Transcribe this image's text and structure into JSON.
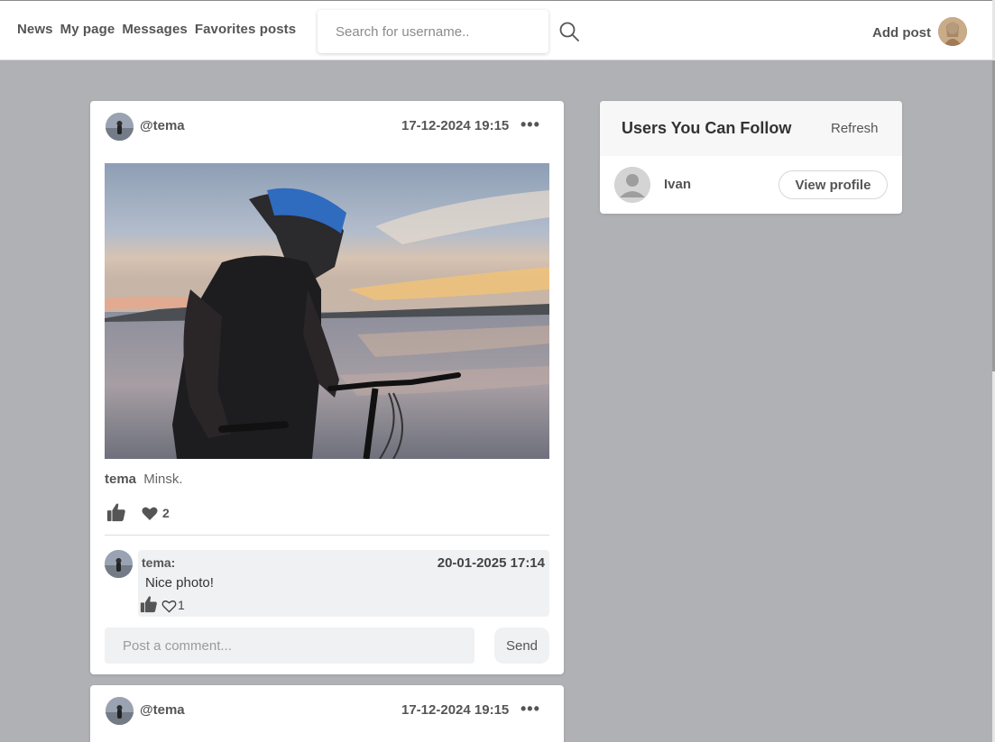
{
  "nav": {
    "items": [
      {
        "label": "News"
      },
      {
        "label": "My page"
      },
      {
        "label": "Messages"
      },
      {
        "label": "Favorites posts"
      }
    ]
  },
  "search": {
    "placeholder": "Search for username.."
  },
  "header": {
    "add_post_label": "Add post"
  },
  "posts": [
    {
      "username": "@tema",
      "date": "17-12-2024 19:15",
      "menu_label": "•••",
      "caption_user": "tema",
      "caption_text": "Minsk.",
      "hearts": "2",
      "comments": [
        {
          "user": "tema:",
          "date": "20-01-2025 17:14",
          "text": "Nice photo!",
          "hearts": "1"
        }
      ],
      "comment_placeholder": "Post a comment...",
      "send_label": "Send"
    },
    {
      "username": "@tema",
      "date": "17-12-2024 19:15",
      "menu_label": "•••"
    }
  ],
  "follow": {
    "title": "Users You Can Follow",
    "refresh_label": "Refresh",
    "users": [
      {
        "name": "Ivan",
        "button_label": "View profile"
      }
    ]
  },
  "icons": {
    "search": "search-icon",
    "like": "thumbs-up-icon",
    "heart": "heart-icon",
    "menu": "more-dots-icon",
    "avatar_placeholder": "user-silhouette-icon"
  }
}
